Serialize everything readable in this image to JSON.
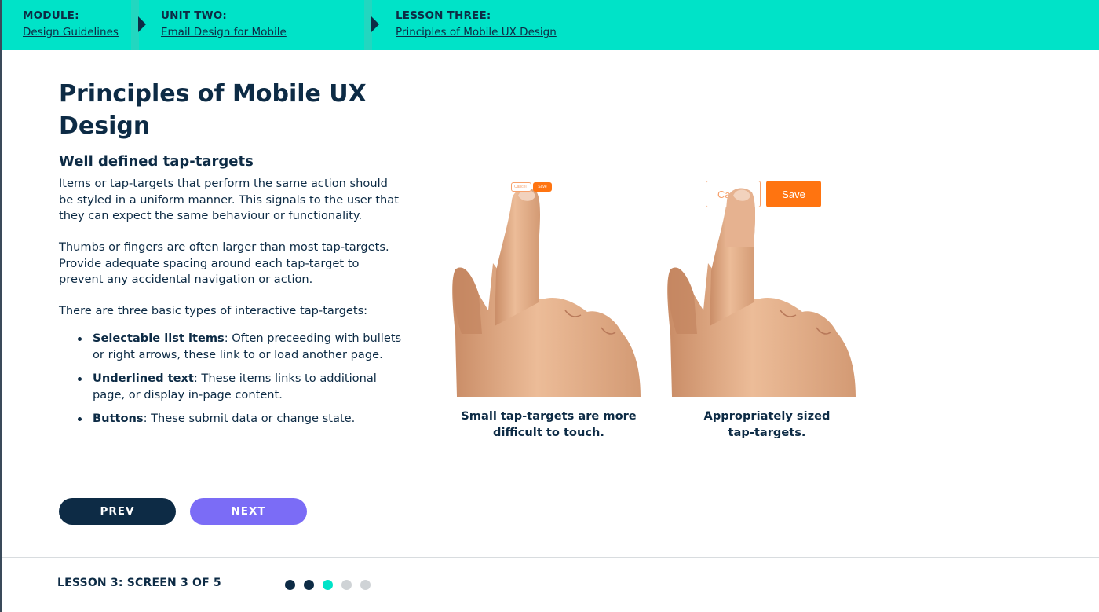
{
  "breadcrumbs": [
    {
      "label": "MODULE:",
      "link": "Design Guidelines"
    },
    {
      "label": "UNIT TWO:",
      "link": "Email Design for Mobile"
    },
    {
      "label": "LESSON THREE:",
      "link": "Principles of Mobile UX Design"
    }
  ],
  "content": {
    "title": "Principles of Mobile UX Design",
    "subtitle": "Well defined tap-targets",
    "paragraphs": [
      "Items or tap-targets that perform the same action should be styled in a uniform manner. This signals to the user that they can expect the same behaviour or functionality.",
      "Thumbs or fingers are often larger than most tap-targets. Provide adequate spacing around each tap-target to prevent any accidental navigation or action.",
      "There are three basic types of interactive tap-targets:"
    ],
    "list": [
      {
        "term": "Selectable list items",
        "text": ": Often preceeding with bullets or right arrows, these link to or load another page."
      },
      {
        "term": "Underlined text",
        "text": ": These items links to additional page, or display in-page content."
      },
      {
        "term": "Buttons",
        "text": ": These submit data or change state."
      }
    ]
  },
  "figures": [
    {
      "caption_line1": "Small tap-targets are more",
      "caption_line2": "difficult to touch.",
      "cancel_label": "Cancel",
      "save_label": "Save"
    },
    {
      "caption_line1": "Appropriately sized",
      "caption_line2": "tap-targets.",
      "cancel_label": "Cancel",
      "save_label": "Save"
    }
  ],
  "nav": {
    "prev_label": "PREV",
    "next_label": "NEXT"
  },
  "footer": {
    "progress_label": "LESSON 3: SCREEN 3 OF 5",
    "total_screens": 5,
    "current_screen": 3
  },
  "colors": {
    "header_bg": "#00e3c8",
    "navy": "#0d2b45",
    "next_button": "#7b6cf6",
    "save_orange": "#ff7410",
    "dot_inactive": "#cfd3d6"
  }
}
